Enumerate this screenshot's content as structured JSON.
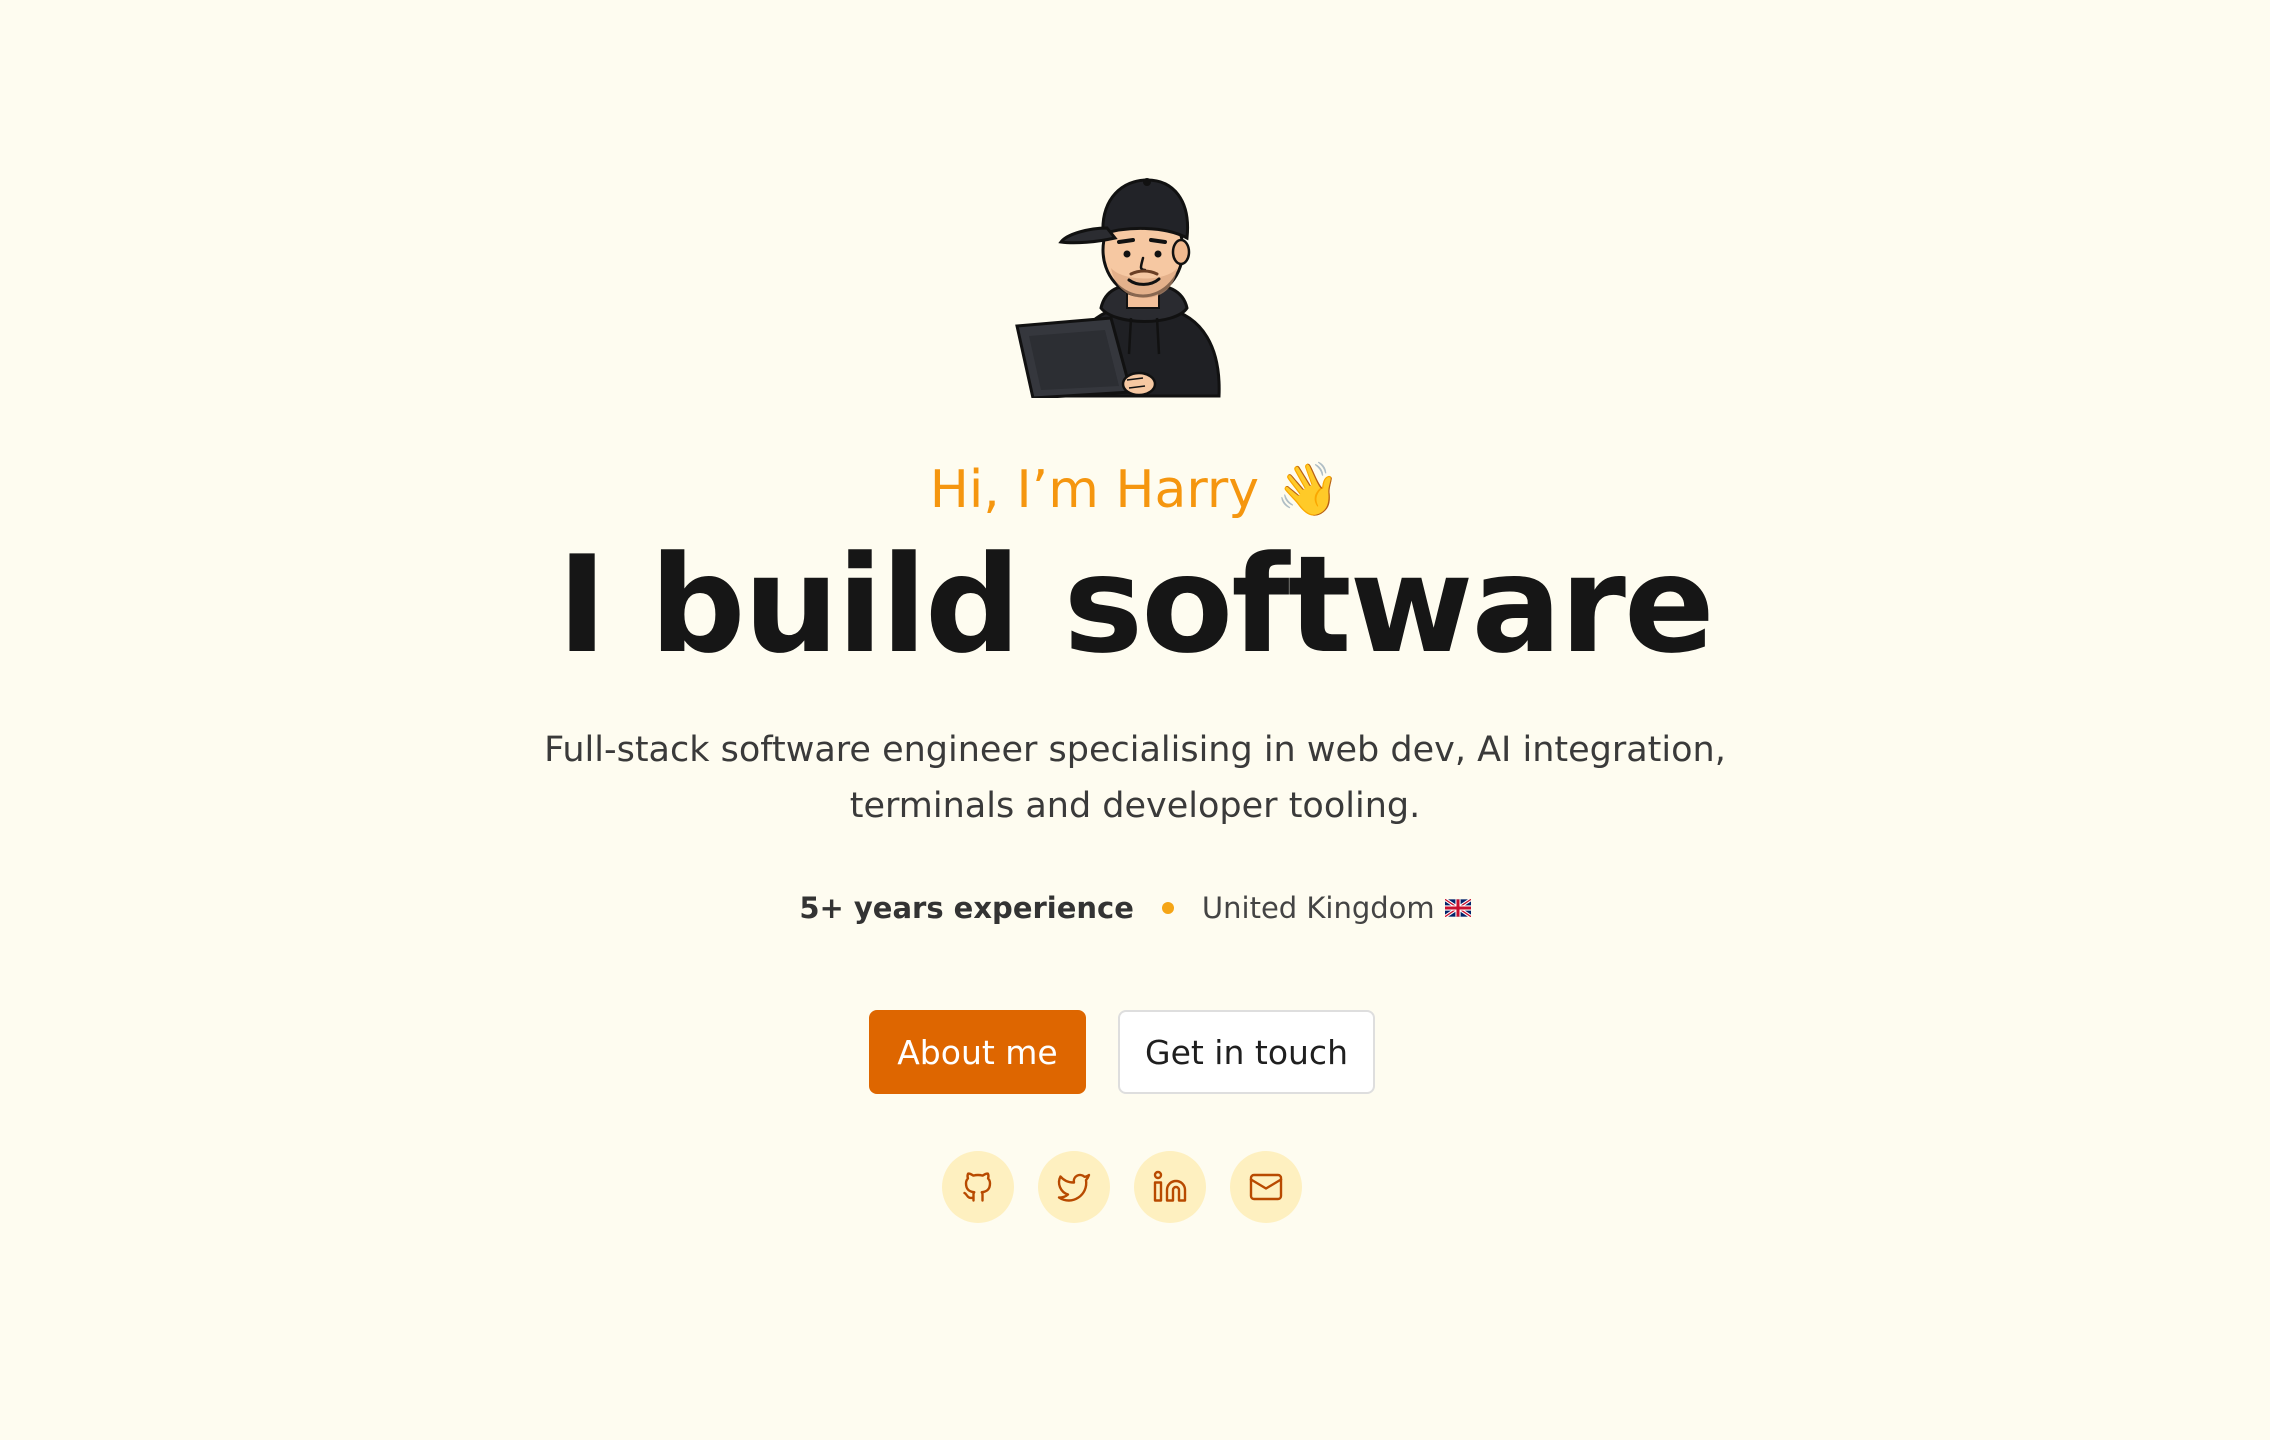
{
  "hero": {
    "greeting": "Hi, I’m Harry",
    "greeting_emoji": "👋",
    "headline": "I build software",
    "subtitle": "Full-stack software engineer specialising in web dev, AI integration, terminals and developer tooling.",
    "experience": "5+ years experience",
    "location": "United Kingdom",
    "location_flag_icon": "uk-flag-icon"
  },
  "buttons": {
    "primary_label": "About me",
    "secondary_label": "Get in touch"
  },
  "socials": [
    {
      "icon": "github-icon"
    },
    {
      "icon": "twitter-icon"
    },
    {
      "icon": "linkedin-icon"
    },
    {
      "icon": "mail-icon"
    }
  ],
  "colors": {
    "background": "#FEFCF0",
    "accent": "#F5960F",
    "primary_button": "#DE6600",
    "social_bg": "#FEF0C0",
    "social_icon": "#B84A00"
  }
}
